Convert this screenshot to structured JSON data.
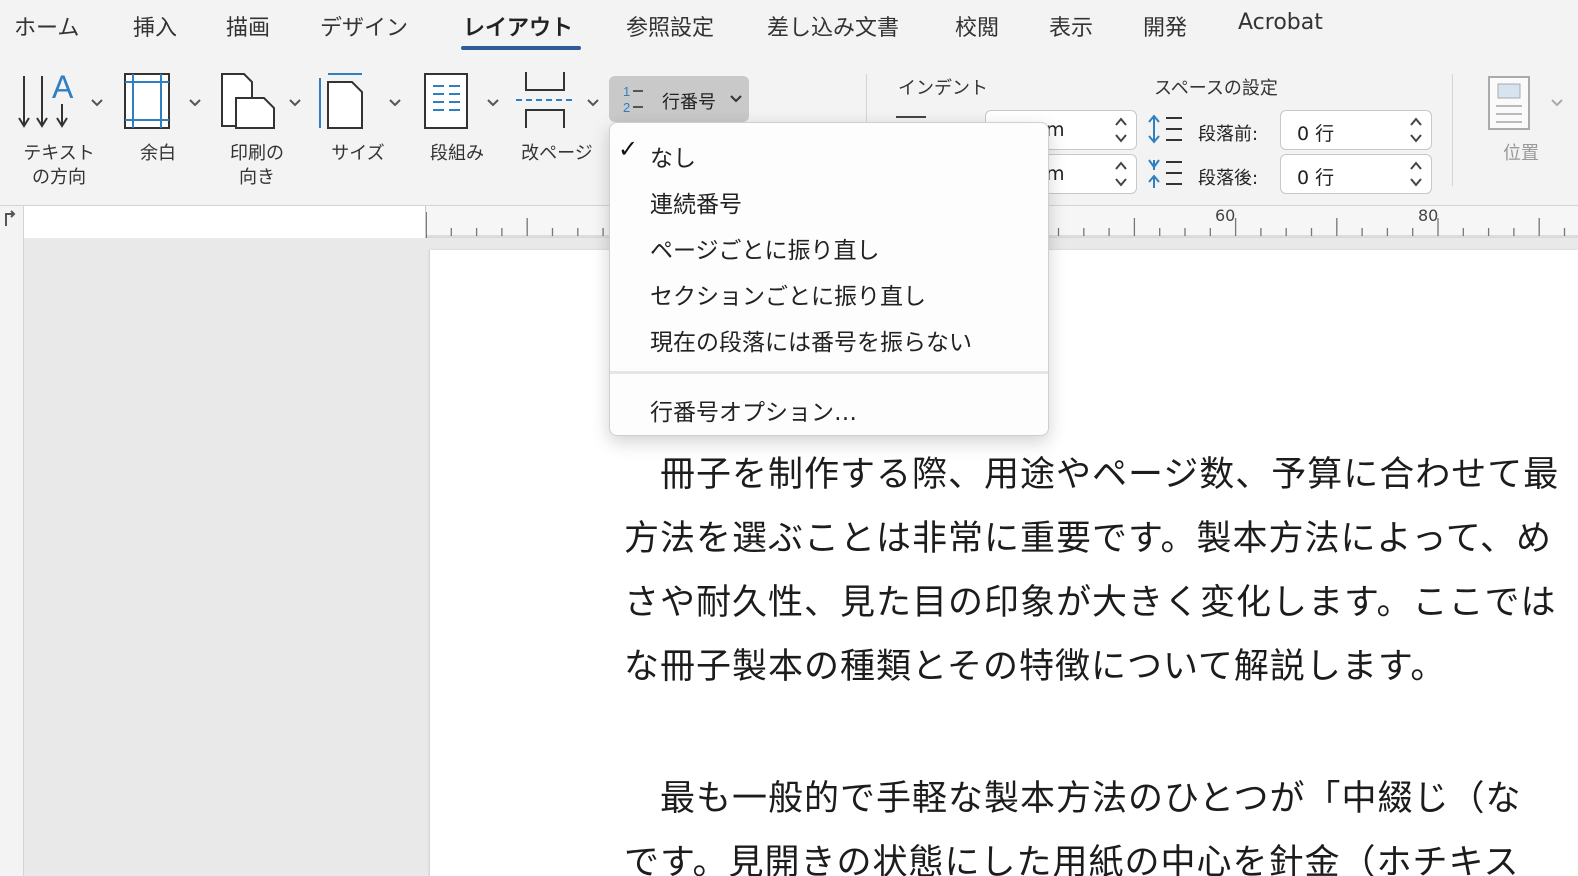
{
  "tabs": [
    "ホーム",
    "挿入",
    "描画",
    "デザイン",
    "レイアウト",
    "参照設定",
    "差し込み文書",
    "校閲",
    "表示",
    "開発",
    "Acrobat"
  ],
  "active_tab": "レイアウト",
  "ribbon": {
    "text_direction": [
      "テキスト",
      "の方向"
    ],
    "margins": "余白",
    "orientation": [
      "印刷の",
      "向き"
    ],
    "size": "サイズ",
    "columns": "段組み",
    "breaks": "改ページ",
    "line_numbers": "行番号",
    "indent_title": "インデント",
    "indent_left_value": "m",
    "indent_right_value": "m",
    "spacing_title": "スペースの設定",
    "spacing_before_label": "段落前:",
    "spacing_before_value": "0 行",
    "spacing_after_label": "段落後:",
    "spacing_after_value": "0 行",
    "position": "位置"
  },
  "ruler": {
    "marks": [
      "60",
      "80"
    ]
  },
  "line_numbers_menu": {
    "items": [
      {
        "label": "なし",
        "checked": true
      },
      {
        "label": "連続番号",
        "checked": false
      },
      {
        "label": "ページごとに振り直し",
        "checked": false
      },
      {
        "label": "セクションごとに振り直し",
        "checked": false
      },
      {
        "label": "現在の段落には番号を振らない",
        "checked": false
      }
    ],
    "options_label": "行番号オプション…",
    "check_glyph": "✓"
  },
  "document": {
    "paragraph1": [
      "　冊子を制作する際、用途やページ数、予算に合わせて最",
      "方法を選ぶことは非常に重要です。製本方法によって、め",
      "さや耐久性、見た目の印象が大きく変化します。ここでは",
      "な冊子製本の種類とその特徴について解説します。"
    ],
    "paragraph2": [
      "　最も一般的で手軽な製本方法のひとつが「中綴じ（な",
      "です。見開きの状態にした用紙の中心を針金（ホチキス"
    ]
  },
  "colors": {
    "accent": "#2e5b9a",
    "icon_blue": "#2f7fc1"
  }
}
